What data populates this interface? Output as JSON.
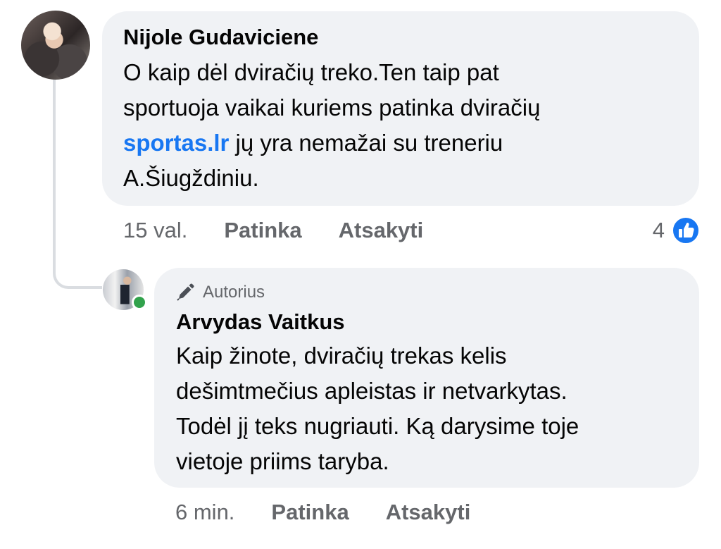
{
  "comment": {
    "author": "Nijole Gudaviciene",
    "text_lines": [
      "O kaip dėl dviračių treko.Ten taip pat",
      "sportuoja vaikai kuriems patinka dviračių"
    ],
    "link_text": "sportas.lr",
    "text_after_link": " jų yra nemažai su treneriu",
    "text_last_line": "A.Šiugždiniu.",
    "timestamp": "15 val.",
    "like_label": "Patinka",
    "reply_label": "Atsakyti",
    "reaction_count": "4",
    "reaction_icon": "like-icon"
  },
  "reply": {
    "badge": "Autorius",
    "badge_icon": "pen-icon",
    "author": "Arvydas Vaitkus",
    "text_lines": [
      "Kaip žinote, dviračių trekas kelis",
      "dešimtmečius apleistas ir netvarkytas.",
      "Todėl jį teks nugriauti. Ką darysime toje",
      "vietoje priims taryba."
    ],
    "timestamp": "6 min.",
    "like_label": "Patinka",
    "reply_label": "Atsakyti",
    "online": true
  },
  "colors": {
    "bubble": "#f0f2f5",
    "link": "#1877f2",
    "secondary_text": "#65676b",
    "online": "#31a24c"
  }
}
